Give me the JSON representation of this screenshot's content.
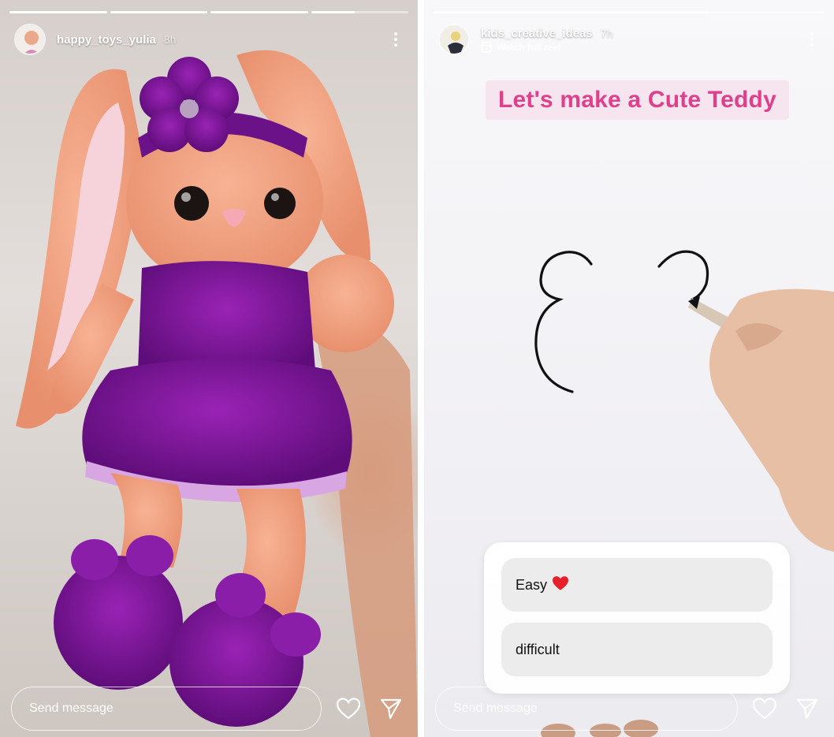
{
  "stories": [
    {
      "username": "happy_toys_yulia",
      "time": "8h",
      "progress": [
        1,
        1,
        1,
        0.45
      ],
      "message_placeholder": "Send message"
    },
    {
      "username": "kids_creative_ideas",
      "time": "7h",
      "subline": "Watch full reel",
      "progress": [
        0.7
      ],
      "title_sticker": "Let's make a Cute Teddy",
      "poll_options": [
        "Easy",
        "difficult"
      ],
      "poll_option_emoji": "❤️",
      "message_placeholder": "Send message"
    }
  ],
  "colors": {
    "accent_pink": "#e0408b",
    "sticker_bg": "#f6e4ef",
    "bunny_peach": "#f2a584",
    "dress_purple": "#7a1597"
  },
  "icons": [
    "more-icon",
    "heart-icon",
    "send-icon",
    "reel-icon"
  ]
}
